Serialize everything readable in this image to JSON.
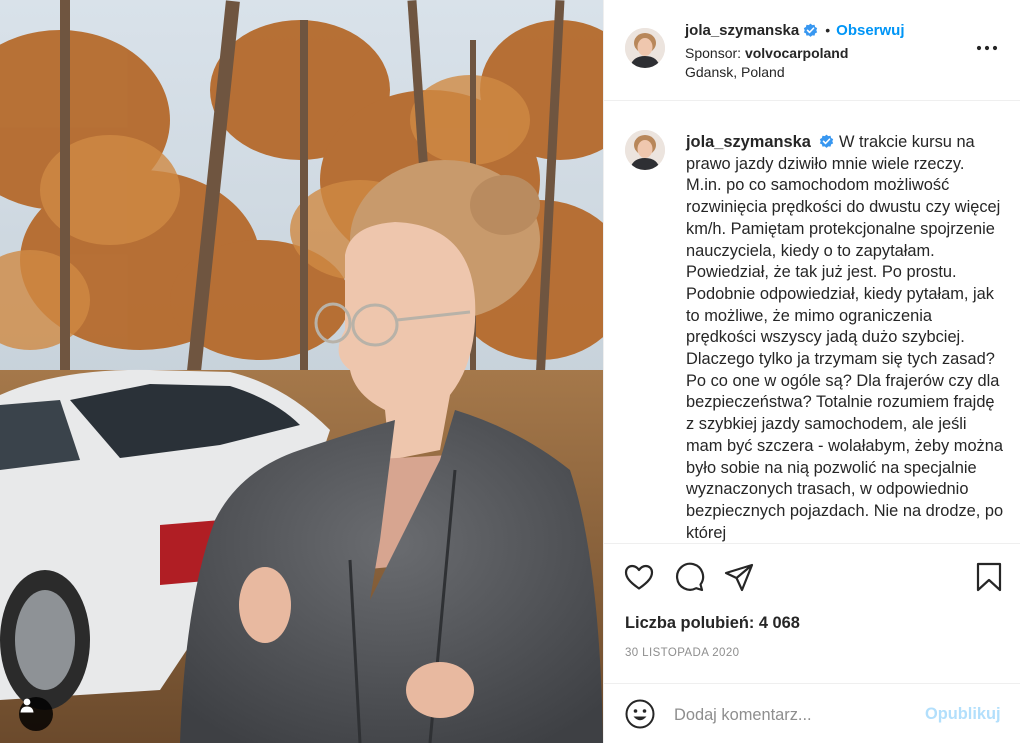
{
  "post": {
    "username": "jola_szymanska",
    "verified": true,
    "dot": "•",
    "follow_label": "Obserwuj",
    "sponsor_label": "Sponsor:",
    "sponsor_name": "volvocarpoland",
    "location": "Gdansk, Poland"
  },
  "caption": {
    "username": "jola_szymanska",
    "text": "W trakcie kursu na prawo jazdy dziwiło mnie wiele rzeczy. M.in. po co samochodom możliwość rozwinięcia prędkości do dwustu czy więcej km/h. Pamiętam protekcjonalne spojrzenie nauczyciela, kiedy o to zapytałam. Powiedział, że tak już jest. Po prostu. Podobnie odpowiedział, kiedy pytałam, jak to możliwe, że mimo ograniczenia prędkości wszyscy jadą dużo szybciej. Dlaczego tylko ja trzymam się tych zasad? Po co one w ogóle są? Dla frajerów czy dla bezpieczeństwa? Totalnie rozumiem frajdę z szybkiej jazdy samochodem, ale jeśli mam być szczera - wolałabym, żeby można było sobie na nią pozwolić na specjalnie wyznaczonych trasach, w odpowiednio bezpiecznych pojazdach. Nie na drodze, po której"
  },
  "stats": {
    "likes": "Liczba polubień: 4 068",
    "date": "30 LISTOPADA 2020"
  },
  "comment": {
    "placeholder": "Dodaj komentarz...",
    "publish_label": "Opublikuj"
  },
  "icons": {
    "like": "heart-icon",
    "comment": "comment-icon",
    "share": "paper-plane-icon",
    "save": "bookmark-icon",
    "emoji": "smiley-icon",
    "more": "more-options-icon",
    "tags": "user-tag-icon"
  },
  "colors": {
    "link": "#0095f6",
    "verified": "#3897f0",
    "muted": "#8e8e8e",
    "publish_disabled": "#b2dffc",
    "border": "#efefef"
  }
}
